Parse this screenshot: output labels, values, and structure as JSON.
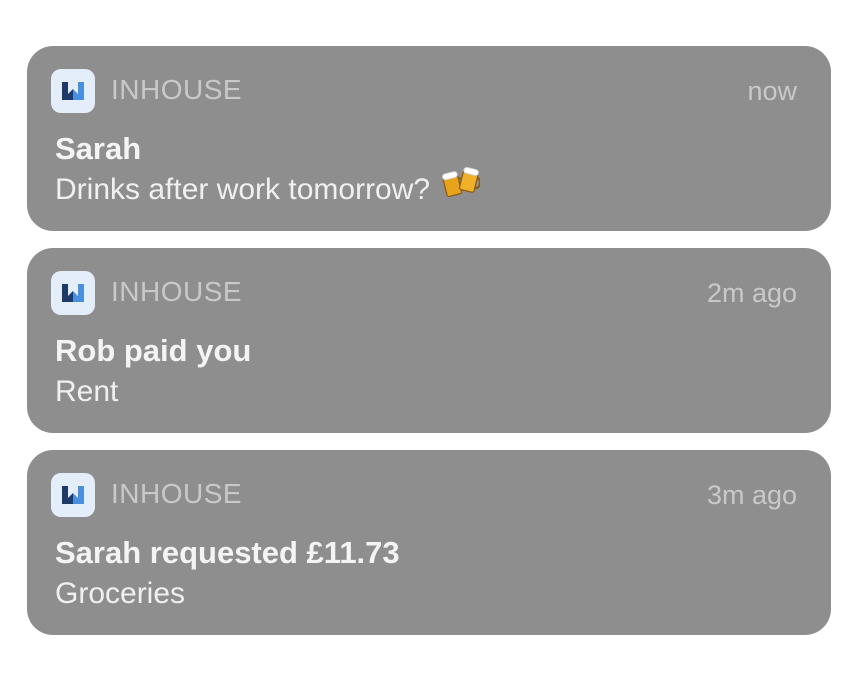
{
  "notifications": [
    {
      "app_name": "INHOUSE",
      "time": "now",
      "title": "Sarah",
      "body": "Drinks after work tomorrow?",
      "emoji": "beer-mugs"
    },
    {
      "app_name": "INHOUSE",
      "time": "2m ago",
      "title": "Rob paid you",
      "body": "Rent"
    },
    {
      "app_name": "INHOUSE",
      "time": "3m ago",
      "title": "Sarah requested £11.73",
      "body": "Groceries"
    }
  ],
  "colors": {
    "card_background": "#8e8e8f",
    "icon_background": "#e4eefb",
    "icon_accent_dark": "#1f3a68",
    "icon_accent_light": "#4a8ee0"
  }
}
